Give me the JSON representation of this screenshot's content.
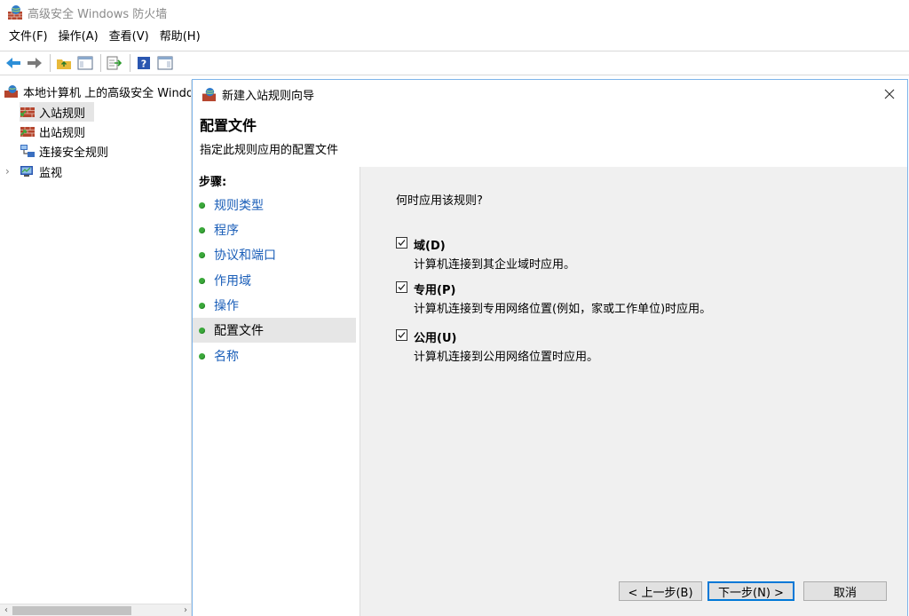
{
  "window": {
    "title": "高级安全 Windows 防火墙"
  },
  "menubar": {
    "items": [
      "文件(F)",
      "操作(A)",
      "查看(V)",
      "帮助(H)"
    ]
  },
  "toolbar": {
    "buttons": [
      "back-icon",
      "forward-icon",
      "up-folder-icon",
      "show-hide-console-tree-icon",
      "export-list-icon",
      "help-icon",
      "show-hide-action-pane-icon"
    ]
  },
  "tree": {
    "root": "本地计算机 上的高级安全 Windows 防火墙",
    "items": [
      {
        "label": "入站规则",
        "selected": true
      },
      {
        "label": "出站规则"
      },
      {
        "label": "连接安全规则"
      },
      {
        "label": "监视"
      }
    ]
  },
  "wizard": {
    "title": "新建入站规则向导",
    "header_title": "配置文件",
    "header_subtitle": "指定此规则应用的配置文件",
    "steps_label": "步骤:",
    "steps": [
      "规则类型",
      "程序",
      "协议和端口",
      "作用域",
      "操作",
      "配置文件",
      "名称"
    ],
    "current_step": 5,
    "question": "何时应用该规则?",
    "options": [
      {
        "label": "域(D)",
        "description": "计算机连接到其企业域时应用。",
        "checked": true
      },
      {
        "label": "专用(P)",
        "description": "计算机连接到专用网络位置(例如，家或工作单位)时应用。",
        "checked": true
      },
      {
        "label": "公用(U)",
        "description": "计算机连接到公用网络位置时应用。",
        "checked": true
      }
    ],
    "buttons": {
      "back": "< 上一步(B)",
      "next": "下一步(N) >",
      "cancel": "取消"
    }
  },
  "colors": {
    "link": "#1a5eb8",
    "step_dot": "#3aa83a",
    "dialog_border": "#7eb4ea",
    "default_button_border": "#0078d7"
  }
}
